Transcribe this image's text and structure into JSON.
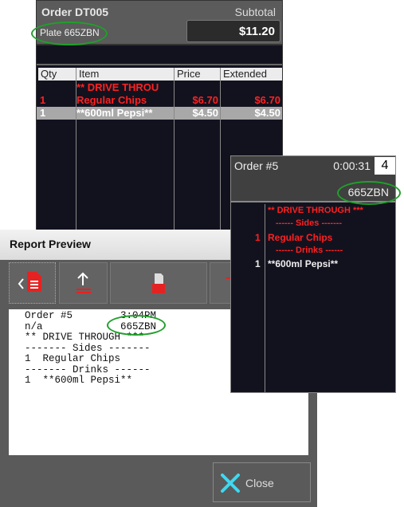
{
  "pos": {
    "order_title": "Order DT005",
    "subtotal_label": "Subtotal",
    "plate": "Plate 665ZBN",
    "subtotal": "$11.20",
    "columns": [
      "Qty",
      "Item",
      "Price",
      "Extended"
    ],
    "rows": [
      {
        "qty": "",
        "item": "** DRIVE THROU",
        "price": "",
        "extended": "",
        "style": "red"
      },
      {
        "qty": "1",
        "item": "Regular Chips",
        "price": "$6.70",
        "extended": "$6.70",
        "style": "red"
      },
      {
        "qty": "1",
        "item": "**600ml Pepsi**",
        "price": "$4.50",
        "extended": "$4.50",
        "style": "selected"
      }
    ]
  },
  "kitchen_ticket": {
    "order": "Order #5",
    "timer": "0:00:31",
    "number": "4",
    "plate": "665ZBN",
    "lines": [
      {
        "qty": "",
        "text": "** DRIVE THROUGH ***",
        "color": "red"
      },
      {
        "qty": "",
        "text": "------ Sides -------",
        "color": "red"
      },
      {
        "qty": "1",
        "text": "Regular Chips",
        "color": "red"
      },
      {
        "qty": "",
        "text": "------ Drinks ------",
        "color": "red"
      },
      {
        "qty": "1",
        "text": "**600ml Pepsi**",
        "color": "white"
      }
    ]
  },
  "report_preview": {
    "title": "Report Preview",
    "toolbar": [
      {
        "icon": "back-document-icon"
      },
      {
        "icon": "upload-icon"
      },
      {
        "icon": "print-icon"
      },
      {
        "icon": "partial-icon"
      }
    ],
    "lines": [
      "Order #5        3:04PM",
      "n/a             665ZBN",
      "",
      "** DRIVE THROUGH ***",
      "------- Sides -------",
      "1  Regular Chips",
      "------- Drinks ------",
      "1  **600ml Pepsi**"
    ],
    "close_label": "Close"
  },
  "colors": {
    "highlight_ring": "#1fa02a",
    "red_text": "#ff2020",
    "close_x": "#3fd8f0"
  }
}
